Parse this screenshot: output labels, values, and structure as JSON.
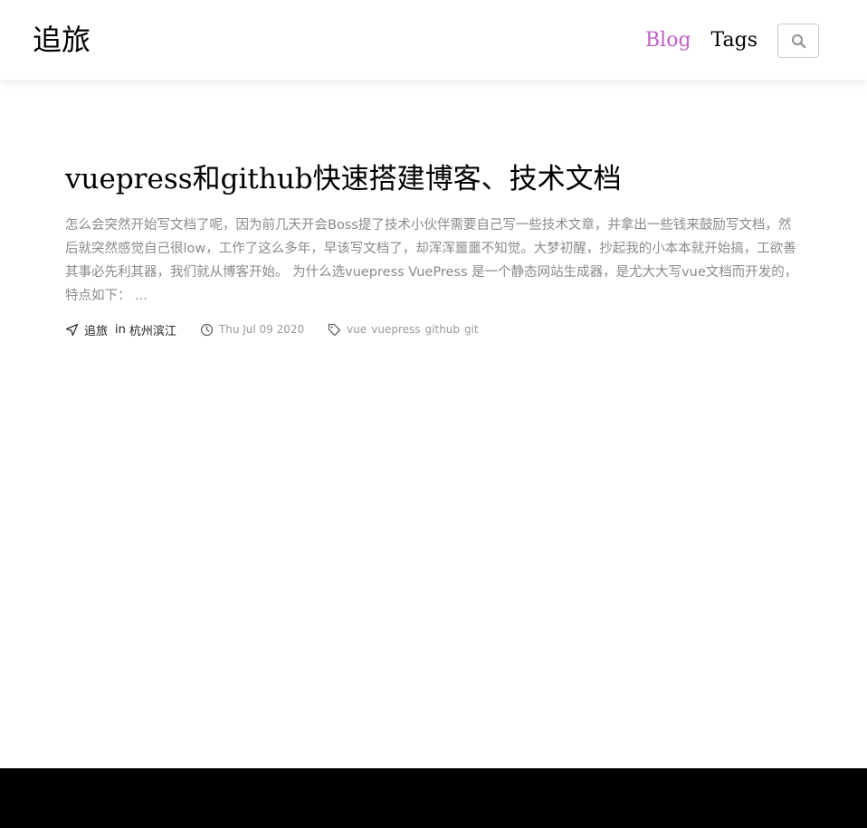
{
  "header": {
    "site_title": "追旅",
    "nav": [
      {
        "label": "Blog",
        "active": true
      },
      {
        "label": "Tags",
        "active": false
      }
    ],
    "search_icon": "search-icon"
  },
  "post": {
    "title": "vuepress和github快速搭建博客、技术文档",
    "excerpt": "怎么会突然开始写文档了呢，因为前几天开会Boss提了技术小伙伴需要自己写一些技术文章，并拿出一些钱来鼓励写文档，然后就突然感觉自己很low，工作了这么多年，早该写文档了，却浑浑噩噩不知觉。大梦初醒，抄起我的小本本就开始搞，工欲善其事必先利其器，我们就从博客开始。 为什么选vuepress VuePress 是一个静态网站生成器，是尤大大写vue文档而开发的，特点如下： ...",
    "author": "追旅",
    "in_label": "in",
    "location": "杭州滨江",
    "date": "Thu Jul 09 2020",
    "tags": [
      "vue",
      "vuepress",
      "github",
      "git"
    ]
  },
  "colors": {
    "accent": "#c160c9",
    "excerpt": "#8a8a8a",
    "meta_muted": "#999999",
    "footer": "#000000"
  }
}
